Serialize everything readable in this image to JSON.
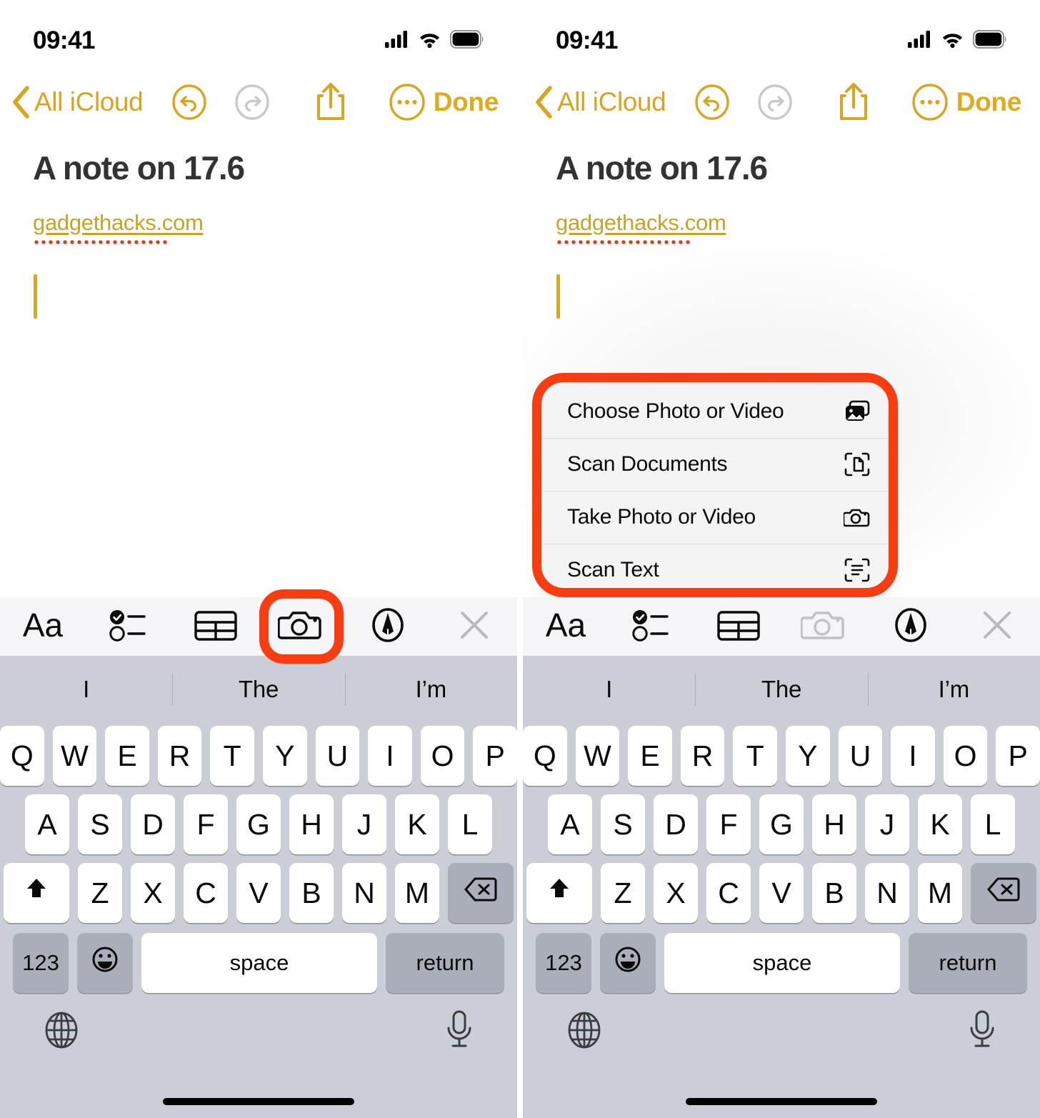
{
  "screen": {
    "status": {
      "time": "09:41",
      "cellular_icon": "signal-bars-icon",
      "wifi_icon": "wifi-icon",
      "battery_icon": "battery-full-icon"
    },
    "navbar": {
      "back_label": "All iCloud",
      "back_icon": "chevron-left-icon",
      "undo_icon": "undo-icon",
      "redo_icon": "redo-icon",
      "share_icon": "share-icon",
      "more_icon": "more-ellipsis-icon",
      "done_label": "Done"
    },
    "note": {
      "title": "A note on 17.6",
      "link": "gadgethacks.com",
      "caret_color": "#d6a91e"
    },
    "format_toolbar": {
      "items": [
        {
          "name": "text-format-icon",
          "label": "Aa",
          "state": "enabled"
        },
        {
          "name": "checklist-icon",
          "label": "",
          "state": "enabled"
        },
        {
          "name": "table-icon",
          "label": "",
          "state": "enabled"
        },
        {
          "name": "camera-icon",
          "label": "",
          "state": "enabled"
        },
        {
          "name": "markup-pen-icon",
          "label": "",
          "state": "enabled"
        },
        {
          "name": "close-icon",
          "label": "",
          "state": "disabled"
        }
      ]
    },
    "keyboard": {
      "suggestions": [
        "I",
        "The",
        "I’m"
      ],
      "row1": [
        "Q",
        "W",
        "E",
        "R",
        "T",
        "Y",
        "U",
        "I",
        "O",
        "P"
      ],
      "row2": [
        "A",
        "S",
        "D",
        "F",
        "G",
        "H",
        "J",
        "K",
        "L"
      ],
      "row3": [
        "Z",
        "X",
        "C",
        "V",
        "B",
        "N",
        "M"
      ],
      "shift_icon": "shift-arrow-icon",
      "backspace_icon": "backspace-icon",
      "numbers_label": "123",
      "emoji_icon": "emoji-smiley-icon",
      "space_label": "space",
      "return_label": "return",
      "globe_icon": "globe-icon",
      "dictation_icon": "microphone-icon"
    },
    "popup_menu": {
      "items": [
        {
          "label": "Choose Photo or Video",
          "icon": "photos-stack-icon"
        },
        {
          "label": "Scan Documents",
          "icon": "scan-document-icon"
        },
        {
          "label": "Take Photo or Video",
          "icon": "camera-icon"
        },
        {
          "label": "Scan Text",
          "icon": "scan-text-icon"
        }
      ]
    },
    "annotations": {
      "highlight_color": "#fa3c11",
      "accent_color": "#d9a521"
    }
  }
}
